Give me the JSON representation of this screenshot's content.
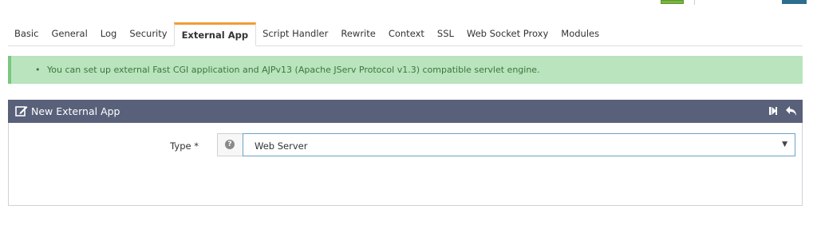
{
  "tabs": [
    {
      "label": "Basic",
      "active": false
    },
    {
      "label": "General",
      "active": false
    },
    {
      "label": "Log",
      "active": false
    },
    {
      "label": "Security",
      "active": false
    },
    {
      "label": "External App",
      "active": true
    },
    {
      "label": "Script Handler",
      "active": false
    },
    {
      "label": "Rewrite",
      "active": false
    },
    {
      "label": "Context",
      "active": false
    },
    {
      "label": "SSL",
      "active": false
    },
    {
      "label": "Web Socket Proxy",
      "active": false
    },
    {
      "label": "Modules",
      "active": false
    }
  ],
  "info": {
    "message": "You can set up external Fast CGI application and AJPv13 (Apache JServ Protocol v1.3) compatible servlet engine."
  },
  "panel": {
    "title": "New External App"
  },
  "form": {
    "type_label": "Type *",
    "type_value": "Web Server"
  },
  "colors": {
    "accent_tab": "#f39c34",
    "panel_header": "#59607a",
    "info_bg": "#b9e4bd",
    "select_border": "#6aa3c9"
  }
}
